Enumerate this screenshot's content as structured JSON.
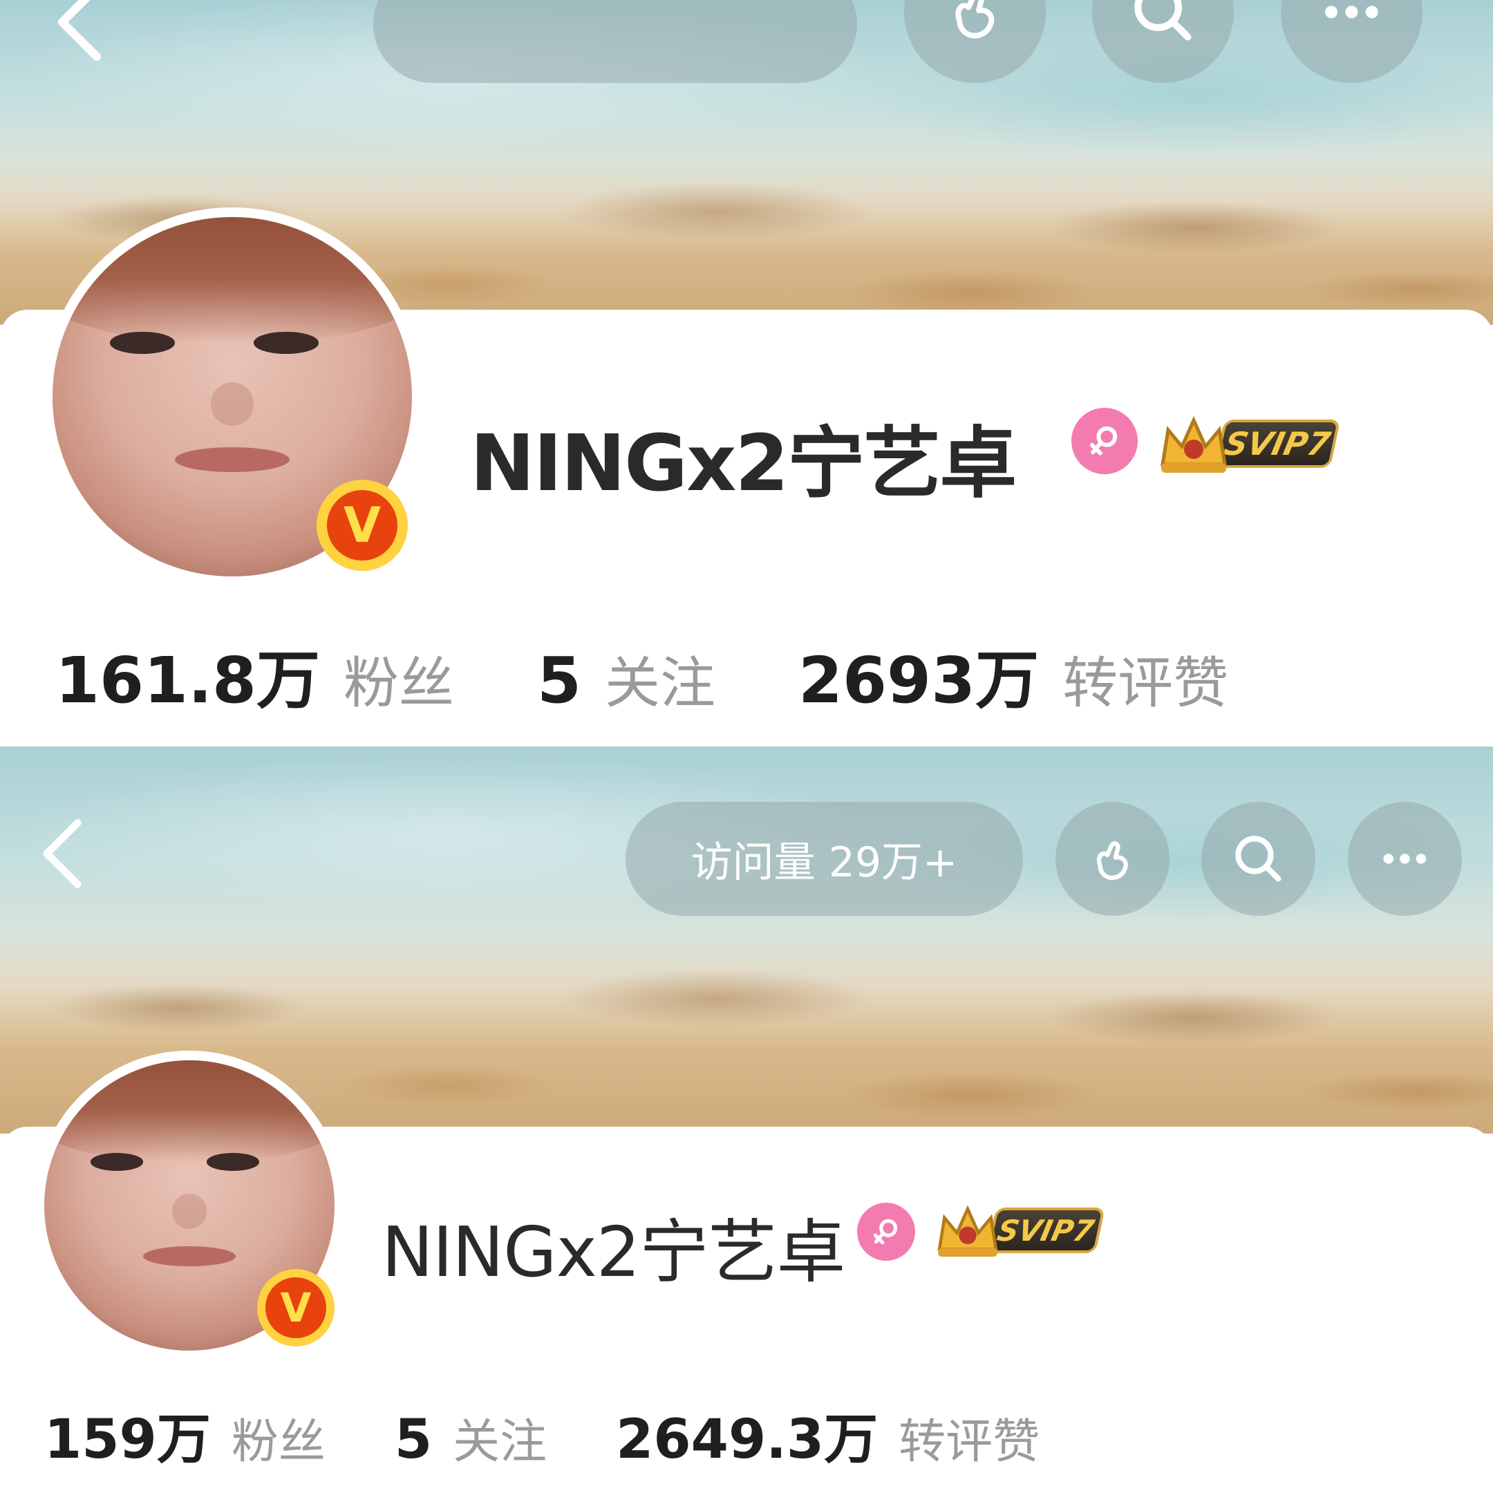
{
  "colors": {
    "banner_sky": "#a9d0d5",
    "banner_sand": "#cda979",
    "gender_badge": "#f47bb0",
    "verified_badge_outer": "#ffd23f",
    "verified_badge_inner": "#e8420f",
    "svip_gold": "#f6c84a",
    "stat_number": "#1f1f1f",
    "stat_label": "#9a9a9a"
  },
  "top_profile": {
    "header": {
      "visits_pill_text": "",
      "icons": [
        "back-icon",
        "finger-heart-icon",
        "search-icon",
        "more-icon"
      ]
    },
    "username": "NINGx2宁艺卓",
    "verified_badge": "V",
    "gender_icon": "female-icon",
    "vip_badge": "SVIP7",
    "stats": [
      {
        "value": "161.8万",
        "label": "粉丝"
      },
      {
        "value": "5",
        "label": "关注"
      },
      {
        "value": "2693万",
        "label": "转评赞"
      }
    ]
  },
  "bottom_profile": {
    "header": {
      "visits_pill_text": "访问量 29万+",
      "icons": [
        "back-icon",
        "finger-heart-icon",
        "search-icon",
        "more-icon"
      ]
    },
    "username": "NINGx2宁艺卓",
    "verified_badge": "V",
    "gender_icon": "female-icon",
    "vip_badge": "SVIP7",
    "stats": [
      {
        "value": "159万",
        "label": "粉丝"
      },
      {
        "value": "5",
        "label": "关注"
      },
      {
        "value": "2649.3万",
        "label": "转评赞"
      }
    ]
  }
}
